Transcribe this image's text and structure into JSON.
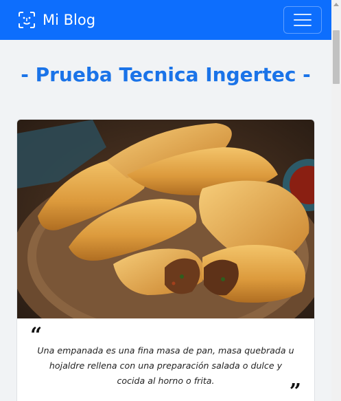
{
  "navbar": {
    "brand": "Mi Blog",
    "brand_icon": "face-scan-icon",
    "toggle_icon": "hamburger-menu-icon",
    "background": "#0d6efd"
  },
  "main": {
    "title": "- Prueba Tecnica Ingertec -",
    "title_color": "#1a73e8"
  },
  "card": {
    "image": "empanadas-photo",
    "quote_open": "“",
    "quote_text": "Una empanada es una fina masa de pan, masa quebrada u hojaldre rellena con una preparación salada o dulce y cocida al horno o frita.",
    "quote_close": "”"
  }
}
